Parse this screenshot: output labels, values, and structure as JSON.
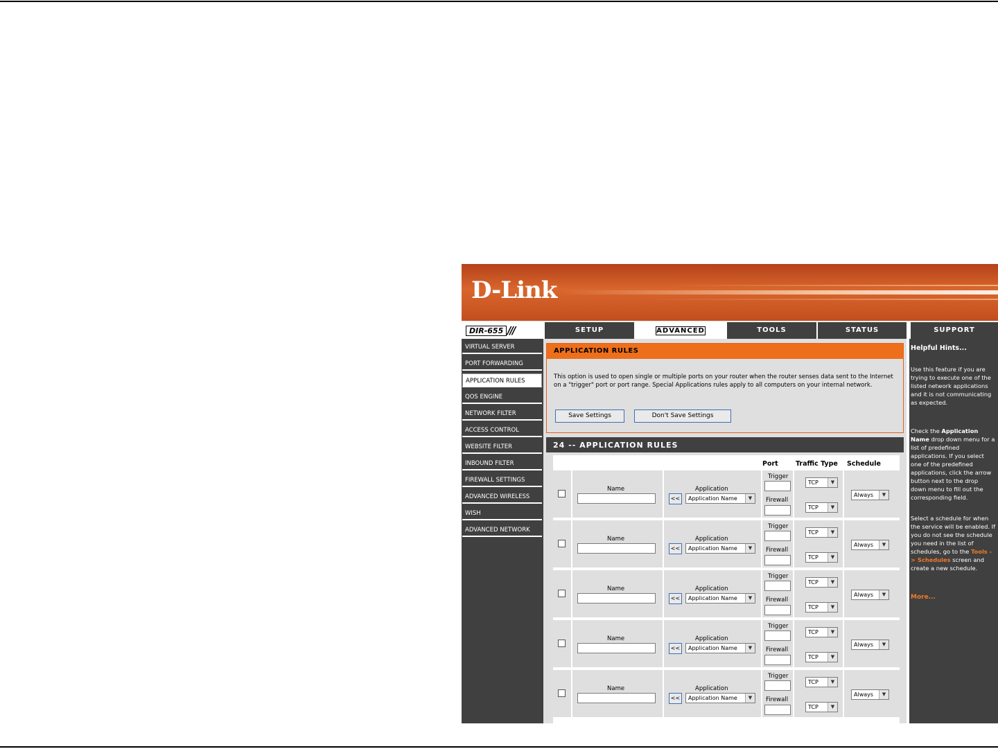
{
  "brand": {
    "logo": "D-Link",
    "model": "DIR-655",
    "slashes": "///"
  },
  "tabs": [
    {
      "label": "SETUP",
      "active": false
    },
    {
      "label": "ADVANCED",
      "active": true
    },
    {
      "label": "TOOLS",
      "active": false
    },
    {
      "label": "STATUS",
      "active": false
    },
    {
      "label": "SUPPORT",
      "active": false
    }
  ],
  "sidebar": {
    "items": [
      {
        "label": "VIRTUAL SERVER"
      },
      {
        "label": "PORT FORWARDING"
      },
      {
        "label": "APPLICATION RULES",
        "active": true
      },
      {
        "label": "QOS ENGINE"
      },
      {
        "label": "NETWORK FILTER"
      },
      {
        "label": "ACCESS CONTROL"
      },
      {
        "label": "WEBSITE FILTER"
      },
      {
        "label": "INBOUND FILTER"
      },
      {
        "label": "FIREWALL SETTINGS"
      },
      {
        "label": "ADVANCED WIRELESS"
      },
      {
        "label": "WISH"
      },
      {
        "label": "ADVANCED NETWORK"
      }
    ]
  },
  "section": {
    "title": "APPLICATION RULES",
    "description": "This option is used to open single or multiple ports on your router when the router senses data sent to the Internet on a \"trigger\" port or port range. Special Applications rules apply to all computers on your internal network.",
    "save_label": "Save Settings",
    "dont_save_label": "Don't Save Settings"
  },
  "rules": {
    "title": "24 -- APPLICATION RULES",
    "headers": {
      "port": "Port",
      "traffic_type": "Traffic Type",
      "schedule": "Schedule"
    },
    "labels": {
      "name": "Name",
      "application": "Application",
      "trigger": "Trigger",
      "firewall": "Firewall",
      "copy": "<<"
    },
    "rows": [
      {
        "name": "",
        "application": "Application Name",
        "trigger_type": "TCP",
        "firewall_type": "TCP",
        "schedule": "Always",
        "checked": false
      },
      {
        "name": "",
        "application": "Application Name",
        "trigger_type": "TCP",
        "firewall_type": "TCP",
        "schedule": "Always",
        "checked": false
      },
      {
        "name": "",
        "application": "Application Name",
        "trigger_type": "TCP",
        "firewall_type": "TCP",
        "schedule": "Always",
        "checked": false
      },
      {
        "name": "",
        "application": "Application Name",
        "trigger_type": "TCP",
        "firewall_type": "TCP",
        "schedule": "Always",
        "checked": false
      },
      {
        "name": "",
        "application": "Application Name",
        "trigger_type": "TCP",
        "firewall_type": "TCP",
        "schedule": "Always",
        "checked": false
      }
    ]
  },
  "hints": {
    "title": "Helpful Hints...",
    "p1": "Use this feature if you are trying to execute one of the listed network applications and it is not communicating as expected.",
    "p2_pre": "Check the ",
    "p2_bold": "Application Name",
    "p2_post": " drop down menu for a list of predefined applications. If you select one of the predefined applications, click the arrow button next to the drop down menu to fill out the corresponding field.",
    "p3_pre": "Select a schedule for when the service will be enabled. If you do not see the schedule you need in the list of schedules, go to the ",
    "p3_link": "Tools -> Schedules",
    "p3_post": " screen and create a new schedule.",
    "more": "More..."
  },
  "colors": {
    "orange": "#ee6f1b",
    "dark": "#404040",
    "panel": "#dfdfdf"
  }
}
